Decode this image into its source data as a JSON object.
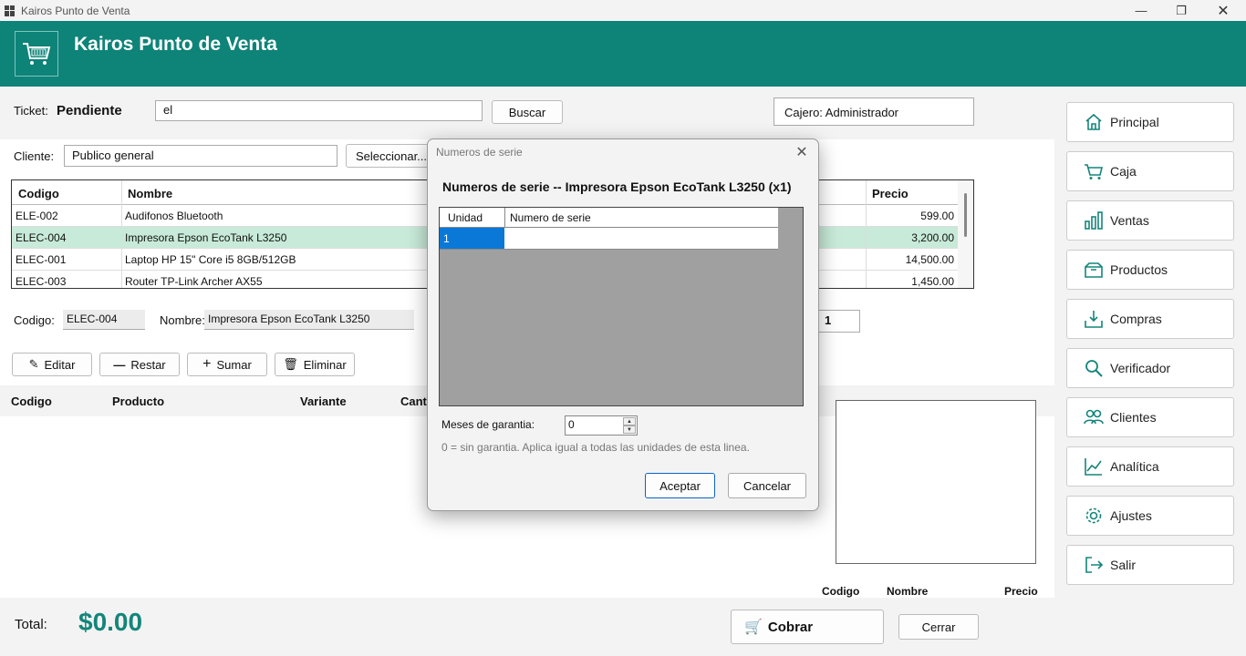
{
  "window": {
    "title": "Kairos Punto de Venta"
  },
  "header": {
    "title": "Kairos Punto de Venta"
  },
  "ticket": {
    "label": "Ticket:",
    "status": "Pendiente",
    "search_value": "el",
    "search_button": "Buscar",
    "cashier": "Cajero: Administrador"
  },
  "client": {
    "label": "Cliente:",
    "value": "Publico general",
    "select_button": "Seleccionar..."
  },
  "products": {
    "columns": [
      "Codigo",
      "Nombre",
      "Precio"
    ],
    "rows": [
      {
        "code": "ELE-002",
        "name": "Audifonos Bluetooth",
        "price": "599.00"
      },
      {
        "code": "ELEC-004",
        "name": "Impresora Epson EcoTank L3250",
        "price": "3,200.00"
      },
      {
        "code": "ELEC-001",
        "name": "Laptop HP 15\" Core i5 8GB/512GB",
        "price": "14,500.00"
      },
      {
        "code": "ELEC-003",
        "name": "Router TP-Link Archer AX55",
        "price": "1,450.00"
      }
    ],
    "selected_index": 1
  },
  "detail": {
    "code_label": "Codigo:",
    "code_value": "ELEC-004",
    "name_label": "Nombre:",
    "name_value": "Impresora Epson EcoTank L3250",
    "quantity": "1"
  },
  "actions": {
    "edit": "Editar",
    "subtract": "Restar",
    "add": "Sumar",
    "delete": "Eliminar"
  },
  "cart": {
    "columns": [
      "Codigo",
      "Producto",
      "Variante",
      "Canti"
    ]
  },
  "mini_table": {
    "columns": [
      "Codigo",
      "Nombre",
      "Precio"
    ]
  },
  "totals": {
    "label": "Total:",
    "amount": "$0.00",
    "charge_button": "Cobrar",
    "close_button": "Cerrar"
  },
  "sidebar": {
    "items": [
      {
        "label": "Principal",
        "icon": "home-icon"
      },
      {
        "label": "Caja",
        "icon": "cart-icon"
      },
      {
        "label": "Ventas",
        "icon": "bar-chart-icon"
      },
      {
        "label": "Productos",
        "icon": "box-icon"
      },
      {
        "label": "Compras",
        "icon": "download-tray-icon"
      },
      {
        "label": "Verificador",
        "icon": "search-icon"
      },
      {
        "label": "Clientes",
        "icon": "users-icon"
      },
      {
        "label": "Analítica",
        "icon": "line-chart-icon"
      },
      {
        "label": "Ajustes",
        "icon": "gear-icon"
      },
      {
        "label": "Salir",
        "icon": "logout-icon"
      }
    ]
  },
  "dialog": {
    "title": "Numeros de serie",
    "heading": "Numeros de serie -- Impresora Epson EcoTank L3250 (x1)",
    "columns": [
      "Unidad",
      "Numero de serie"
    ],
    "rows": [
      {
        "unit": "1",
        "serial": ""
      }
    ],
    "warranty_label": "Meses de garantia:",
    "warranty_value": "0",
    "hint": "0 = sin garantia. Aplica igual a todas las unidades de esta linea.",
    "accept": "Aceptar",
    "cancel": "Cancelar"
  },
  "colors": {
    "brand": "#0e8378",
    "total": "#14857a",
    "selected_row": "#c8ead8",
    "selected_cell": "#0a78d7"
  }
}
